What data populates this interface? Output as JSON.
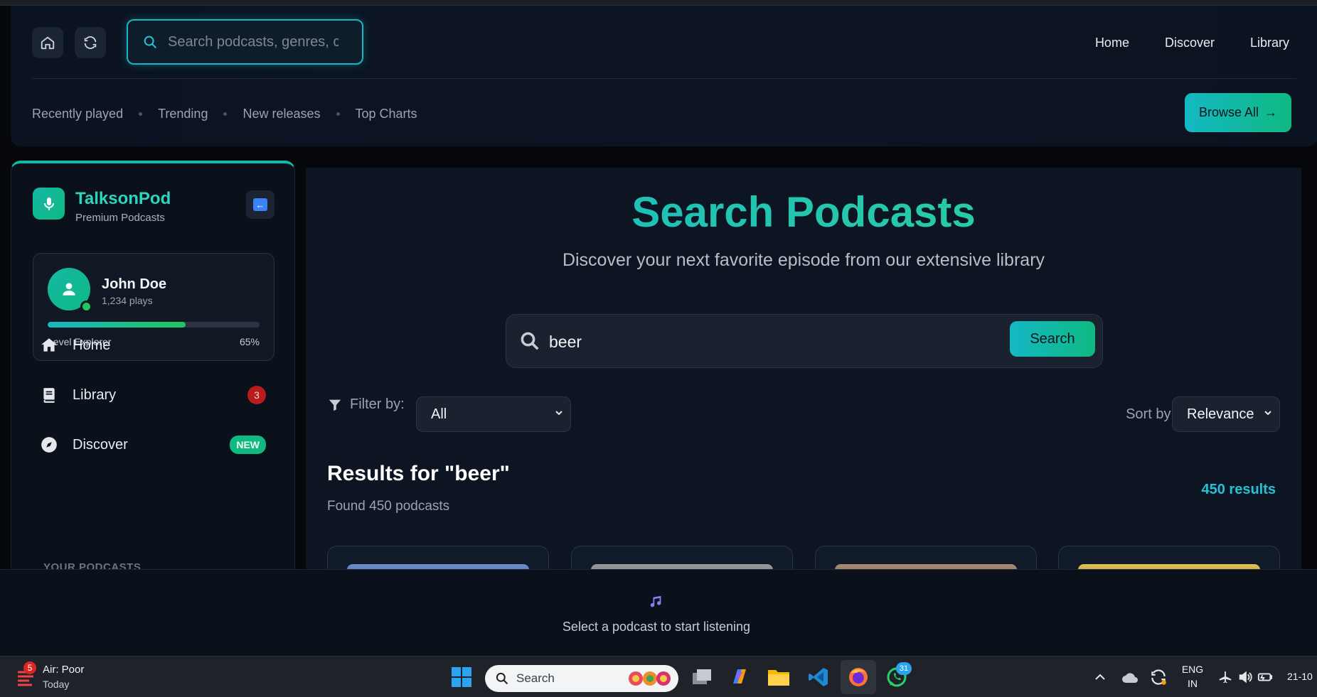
{
  "header": {
    "search_placeholder": "Search podcasts, genres, c",
    "nav": [
      "Home",
      "Discover",
      "Library"
    ],
    "subnav": [
      "Recently played",
      "Trending",
      "New releases",
      "Top Charts"
    ],
    "browse_label": "Browse All",
    "browse_arrow": "→"
  },
  "sidebar": {
    "brand": "TalksonPod",
    "brand_sub": "Premium Podcasts",
    "collapse_glyph": "←",
    "user": {
      "name": "John Doe",
      "plays": "1,234 plays",
      "level_label": "Level Explorer",
      "level_pct": "65%",
      "progress": 0.65
    },
    "items": [
      {
        "label": "Home",
        "icon": "home-icon"
      },
      {
        "label": "Library",
        "icon": "book-icon",
        "badge": "3"
      },
      {
        "label": "Discover",
        "icon": "compass-icon",
        "badge": "NEW"
      }
    ],
    "section_label": "YOUR PODCASTS"
  },
  "main": {
    "title": "Search Podcasts",
    "subtitle": "Discover your next favorite episode from our extensive library",
    "search_value": "beer",
    "search_button": "Search",
    "filter_label": "Filter by:",
    "filter_value": "All",
    "sort_label": "Sort by:",
    "sort_value": "Relevance",
    "results_title": "Results for \"beer\"",
    "results_found": "Found 450 podcasts",
    "results_count": "450 results"
  },
  "player": {
    "empty_text": "Select a podcast to start listening"
  },
  "taskbar": {
    "weather_badge": "5",
    "weather_line1": "Air: Poor",
    "weather_line2": "Today",
    "search_label": "Search",
    "whatsapp_badge": "31",
    "lang_line1": "ENG",
    "lang_line2": "IN",
    "time": "21-10"
  },
  "colors": {
    "accent": "#14b8c4",
    "accent_green": "#10b981",
    "background": "#0d1422"
  }
}
